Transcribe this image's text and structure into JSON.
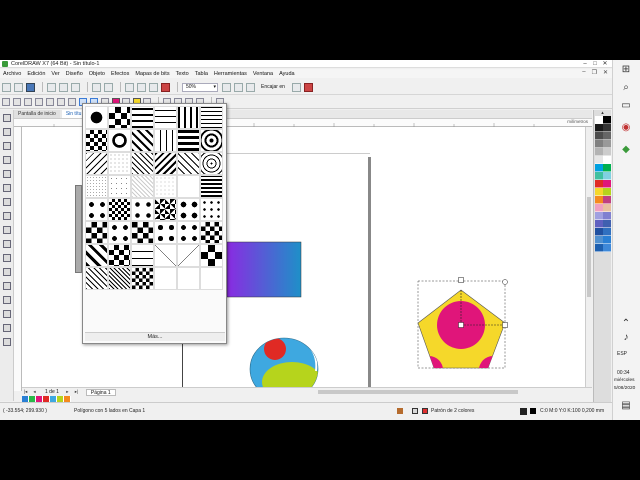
{
  "window": {
    "title": "CorelDRAW X7 (64 Bit) - Sin título-1"
  },
  "menu": {
    "items": [
      "Archivo",
      "Edición",
      "Ver",
      "Diseño",
      "Objeto",
      "Efectos",
      "Mapas de bits",
      "Texto",
      "Tabla",
      "Herramientas",
      "Ventana",
      "Ayuda"
    ]
  },
  "toolbar": {
    "zoom": "50%",
    "snap_label": "Encajar en"
  },
  "tabs": {
    "start": "Pantalla de inicio",
    "document": "Sin títu"
  },
  "ruler": {
    "unit": "milímetros"
  },
  "pattern_picker": {
    "more_label": "Más..."
  },
  "page_nav": {
    "page_count": "1 de 1",
    "page_tab": "Página 1"
  },
  "status": {
    "coordinates": "( -33.554; 299.930 )",
    "object_info": "Polígono con 5 lados en Capa 1",
    "fill_info": "Patrón de 2 colores",
    "outline_info": "C:0 M:0 Y:0 K:100  0,200 mm"
  },
  "taskbar": {
    "language": "ESP",
    "time": "00:34",
    "day": "miércoles",
    "date": "5/08/2020"
  },
  "colors": {
    "accent": "#1a5fb4",
    "rect_gradient_start": "#8a2be2",
    "rect_gradient_end": "#1e90c8",
    "pentagon_fill": "#f5d82a",
    "pentagon_circle": "#e0157a",
    "ellipse_outer": "#3ea8e0",
    "ellipse_lime": "#b6d41c",
    "ellipse_red": "#e02a24"
  }
}
